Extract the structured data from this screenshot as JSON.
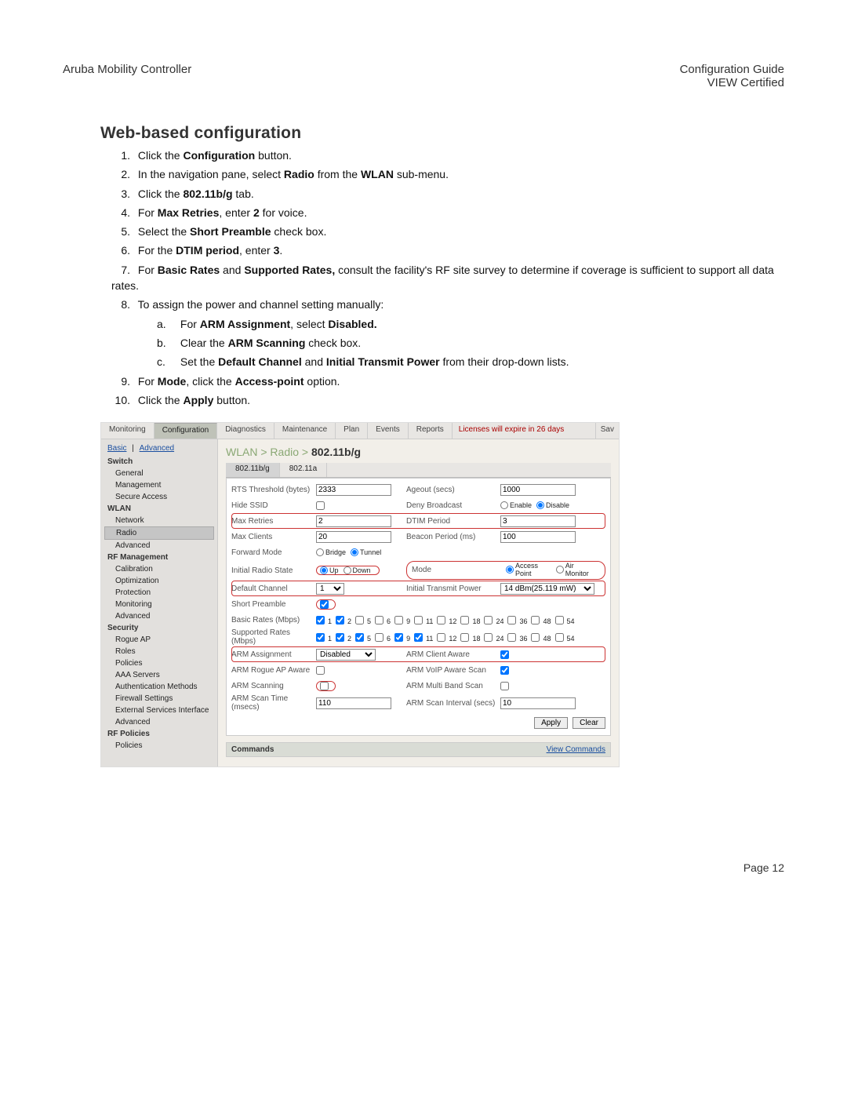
{
  "header": {
    "left": "Aruba Mobility Controller",
    "right1": "Configuration Guide",
    "right2": "VIEW Certified"
  },
  "section_title": "Web-based configuration",
  "steps": {
    "n1_a": "Click the ",
    "n1_b": "Configuration",
    "n1_c": " button.",
    "n2_a": "In the navigation pane, select ",
    "n2_b": "Radio",
    "n2_c": " from the ",
    "n2_d": "WLAN",
    "n2_e": " sub-menu.",
    "n3_a": "Click the ",
    "n3_b": "802.11b/g",
    "n3_c": " tab.",
    "n4_a": "For ",
    "n4_b": "Max Retries",
    "n4_c": ", enter ",
    "n4_d": "2",
    "n4_e": " for voice.",
    "n5_a": "Select the ",
    "n5_b": "Short Preamble",
    "n5_c": " check box.",
    "n6_a": "For the ",
    "n6_b": "DTIM period",
    "n6_c": ", enter ",
    "n6_d": "3",
    "n6_e": ".",
    "n7_a": "For ",
    "n7_b": "Basic Rates",
    "n7_c": " and ",
    "n7_d": "Supported Rates,",
    "n7_e": " consult the facility's RF site survey to determine if coverage is sufficient to support all data rates.",
    "n8_a": "To assign the power and channel setting manually:",
    "n8a_a": "For ",
    "n8a_b": "ARM Assignment",
    "n8a_c": ", select ",
    "n8a_d": "Disabled.",
    "n8b_a": "Clear the ",
    "n8b_b": "ARM Scanning",
    "n8b_c": " check box.",
    "n8c_a": "Set the ",
    "n8c_b": "Default Channel",
    "n8c_c": " and ",
    "n8c_d": "Initial Transmit Power",
    "n8c_e": " from their drop-down lists.",
    "n9_a": "For ",
    "n9_b": "Mode",
    "n9_c": ", click the ",
    "n9_d": "Access-point",
    "n9_e": " option.",
    "n10_a": "Click the ",
    "n10_b": "Apply",
    "n10_c": " button."
  },
  "screenshot": {
    "top_tabs": [
      "Monitoring",
      "Configuration",
      "Diagnostics",
      "Maintenance",
      "Plan",
      "Events",
      "Reports"
    ],
    "selected_top_tab": "Configuration",
    "license_text": "Licenses will expire in 26 days",
    "save_label": "Sav",
    "sidebar": {
      "top_links": [
        "Basic",
        "Advanced"
      ],
      "groups": [
        {
          "head": "Switch",
          "items": [
            "General",
            "Management",
            "Secure Access"
          ]
        },
        {
          "head": "WLAN",
          "items": [
            "Network",
            "Radio",
            "Advanced"
          ]
        },
        {
          "head": "RF Management",
          "items": [
            "Calibration",
            "Optimization",
            "Protection",
            "Monitoring",
            "Advanced"
          ]
        },
        {
          "head": "Security",
          "items": [
            "Rogue AP",
            "Roles",
            "Policies",
            "AAA Servers",
            "Authentication Methods",
            "Firewall Settings",
            "External Services Interface",
            "Advanced"
          ]
        },
        {
          "head": "RF Policies",
          "items": [
            "Policies"
          ]
        }
      ],
      "selected_item": "Radio"
    },
    "breadcrumb": {
      "a": "WLAN",
      "b": "Radio",
      "c": "802.11b/g"
    },
    "inner_tabs": [
      "802.11b/g",
      "802.11a"
    ],
    "selected_inner_tab": "802.11b/g",
    "labels": {
      "rts": "RTS Threshold (bytes)",
      "ageout": "Ageout (secs)",
      "hide": "Hide SSID",
      "deny": "Deny Broadcast",
      "maxr": "Max Retries",
      "dtim": "DTIM Period",
      "maxc": "Max Clients",
      "beacon": "Beacon Period (ms)",
      "fmode": "Forward Mode",
      "irs": "Initial Radio State",
      "mode": "Mode",
      "defch": "Default Channel",
      "itp": "Initial Transmit Power",
      "short": "Short Preamble",
      "basic": "Basic Rates (Mbps)",
      "support": "Supported Rates (Mbps)",
      "arma": "ARM Assignment",
      "armca": "ARM Client Aware",
      "armr": "ARM Rogue AP Aware",
      "armv": "ARM VoIP Aware Scan",
      "arms": "ARM Scanning",
      "armmb": "ARM Multi Band Scan",
      "armst": "ARM Scan Time (msecs)",
      "armsi": "ARM Scan Interval (secs)"
    },
    "values": {
      "rts": "2333",
      "ageout": "1000",
      "maxr": "2",
      "dtim": "3",
      "maxc": "20",
      "beacon": "100",
      "defch": "1",
      "itp": "14 dBm(25.119 mW)",
      "arma": "Disabled",
      "armst": "110",
      "armsi": "10"
    },
    "radio_opts": {
      "deny": [
        "Enable",
        "Disable"
      ],
      "fmode": [
        "Bridge",
        "Tunnel"
      ],
      "irs": [
        "Up",
        "Down"
      ],
      "mode": [
        "Access Point",
        "Air Monitor"
      ]
    },
    "rates": [
      "1",
      "2",
      "5",
      "6",
      "9",
      "11",
      "12",
      "18",
      "24",
      "36",
      "48",
      "54"
    ],
    "basic_checked": [
      "1",
      "2"
    ],
    "supported_checked": [
      "1",
      "2",
      "5",
      "9",
      "11"
    ],
    "buttons": {
      "apply": "Apply",
      "clear": "Clear"
    },
    "commands": {
      "title": "Commands",
      "link": "View Commands"
    }
  },
  "footer": "Page 12"
}
